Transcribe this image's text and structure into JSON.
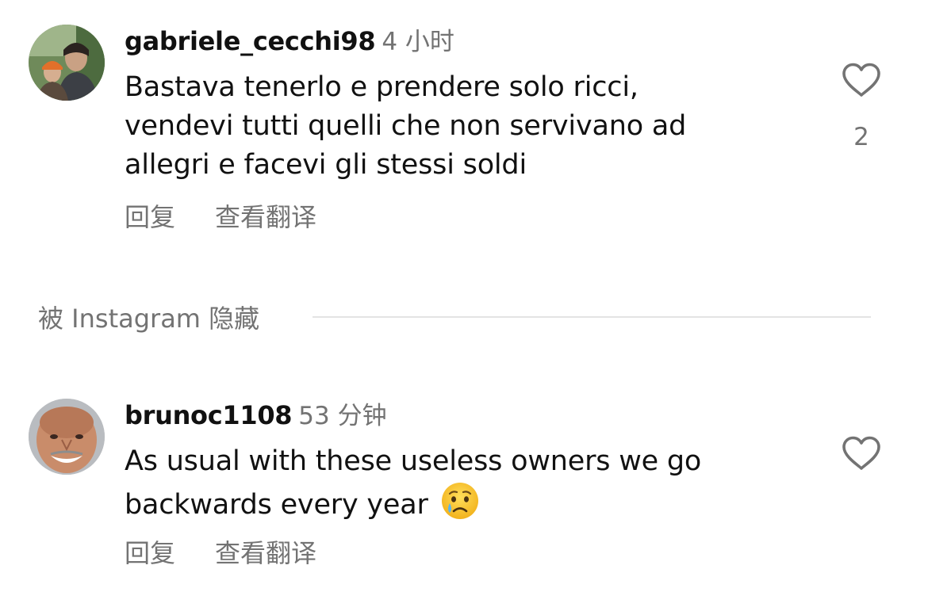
{
  "comments": [
    {
      "username": "gabriele_cecchi98",
      "time": "4 小时",
      "text_lines": [
        "Bastava tenerlo e prendere solo ricci,",
        "vendevi tutti quelli che non servivano ad",
        "allegri e facevi gli stessi soldi"
      ],
      "reply_label": "回复",
      "translate_label": "查看翻译",
      "like_count": "2",
      "avatar_icon": "avatar-photo-two-people",
      "like_icon": "heart-outline-icon"
    },
    {
      "username": "brunoc1108",
      "time": "53 分钟",
      "text_lines": [
        "As usual with these useless owners we go",
        "backwards every year"
      ],
      "emoji": "crying-face-emoji",
      "reply_label": "回复",
      "translate_label": "查看翻译",
      "avatar_icon": "avatar-photo-smiling-man",
      "like_icon": "heart-outline-icon"
    }
  ],
  "hidden_notice": "被 Instagram 隐藏",
  "colors": {
    "text_primary": "#111111",
    "text_secondary": "#737373",
    "divider": "#e3e3e3"
  }
}
